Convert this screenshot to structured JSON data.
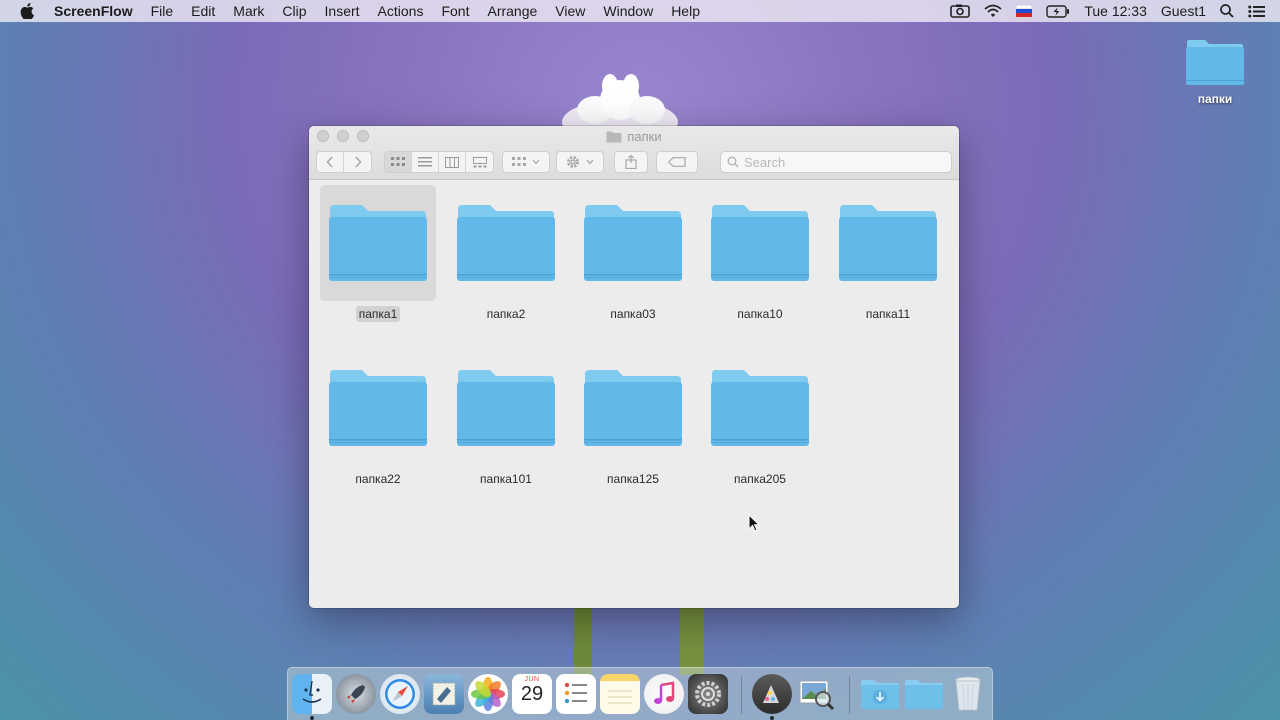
{
  "menubar": {
    "apple_icon": "apple-icon",
    "app_name": "ScreenFlow",
    "items": [
      "File",
      "Edit",
      "Mark",
      "Clip",
      "Insert",
      "Actions",
      "Font",
      "Arrange",
      "View",
      "Window",
      "Help"
    ],
    "status": {
      "clock": "Tue 12:33",
      "user": "Guest1"
    }
  },
  "desktop": {
    "folder_label": "папки"
  },
  "finder": {
    "title": "папки",
    "search_placeholder": "Search",
    "items": [
      {
        "name": "папка1",
        "selected": true
      },
      {
        "name": "папка2"
      },
      {
        "name": "папка03"
      },
      {
        "name": "папка10"
      },
      {
        "name": "папка11"
      },
      {
        "name": "папка22"
      },
      {
        "name": "папка101"
      },
      {
        "name": "папка125"
      },
      {
        "name": "папка205"
      }
    ]
  },
  "dock": {
    "calendar_month": "JUN",
    "calendar_day": "29",
    "apps": [
      "finder",
      "launchpad",
      "safari",
      "mail",
      "photos",
      "calendar",
      "reminders",
      "notes",
      "itunes",
      "system-preferences",
      "photo-booth",
      "preview",
      "downloads",
      "documents",
      "trash"
    ]
  },
  "colors": {
    "folder_top": "#7ec8ec",
    "folder_body": "#5fb6e6",
    "accent": "#1a7fe0"
  }
}
